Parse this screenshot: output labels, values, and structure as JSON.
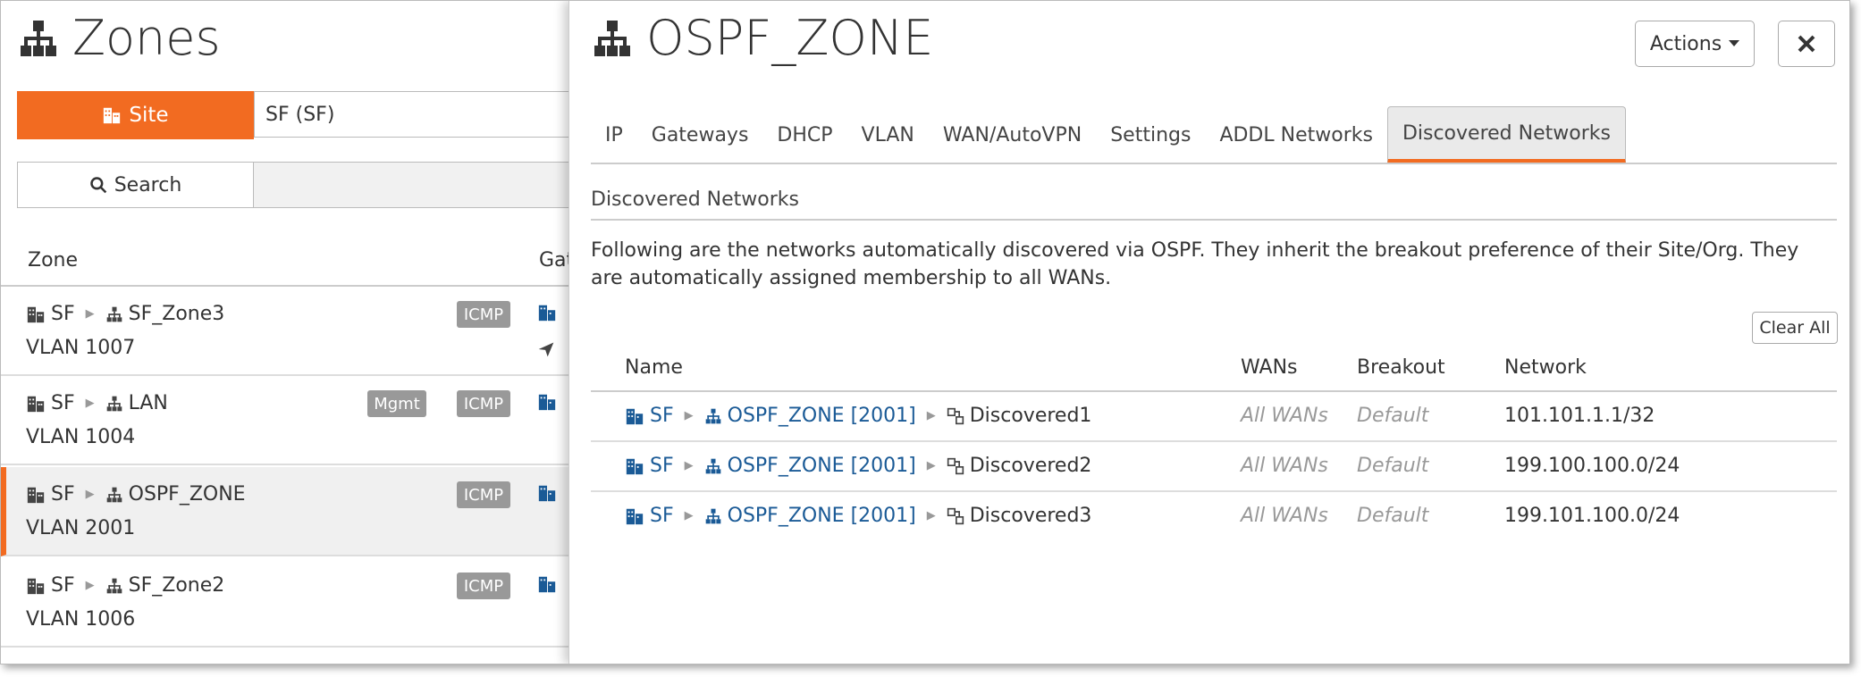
{
  "left": {
    "title": "Zones",
    "site_label": "Site",
    "site_value": "SF (SF)",
    "search_label": "Search",
    "col_zone": "Zone",
    "col_gateway": "Gat",
    "zones": [
      {
        "site": "SF",
        "zone": "SF_Zone3",
        "vlan": "VLAN 1007",
        "mgmt": "",
        "icmp": "ICMP"
      },
      {
        "site": "SF",
        "zone": "LAN",
        "vlan": "VLAN 1004",
        "mgmt": "Mgmt",
        "icmp": "ICMP"
      },
      {
        "site": "SF",
        "zone": "OSPF_ZONE",
        "vlan": "VLAN 2001",
        "mgmt": "",
        "icmp": "ICMP"
      },
      {
        "site": "SF",
        "zone": "SF_Zone2",
        "vlan": "VLAN 1006",
        "mgmt": "",
        "icmp": "ICMP"
      }
    ]
  },
  "right": {
    "title": "OSPF_ZONE",
    "actions_label": "Actions",
    "tabs": [
      "IP",
      "Gateways",
      "DHCP",
      "VLAN",
      "WAN/AutoVPN",
      "Settings",
      "ADDL Networks",
      "Discovered Networks"
    ],
    "section_title": "Discovered Networks",
    "description": "Following are the networks automatically discovered via OSPF. They inherit the breakout preference of their Site/Org. They are automatically assigned membership to all WANs.",
    "clear_all_label": "Clear All",
    "table_headers": {
      "name": "Name",
      "wans": "WANs",
      "breakout": "Breakout",
      "network": "Network"
    },
    "rows": [
      {
        "site": "SF",
        "zone": "OSPF_ZONE [2001]",
        "name": "Discovered1",
        "wans": "All WANs",
        "breakout": "Default",
        "network": "101.101.1.1/32"
      },
      {
        "site": "SF",
        "zone": "OSPF_ZONE [2001]",
        "name": "Discovered2",
        "wans": "All WANs",
        "breakout": "Default",
        "network": "199.100.100.0/24"
      },
      {
        "site": "SF",
        "zone": "OSPF_ZONE [2001]",
        "name": "Discovered3",
        "wans": "All WANs",
        "breakout": "Default",
        "network": "199.101.100.0/24"
      }
    ]
  },
  "colors": {
    "accent": "#f26b21",
    "link": "#1a5a96",
    "badge": "#999999"
  }
}
